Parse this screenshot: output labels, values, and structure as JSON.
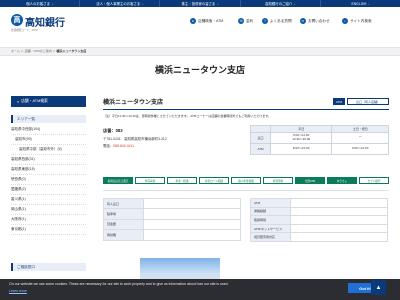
{
  "topnav": [
    {
      "label": "個人のお客さま"
    },
    {
      "label": "法人・個人事業主のお客さま"
    },
    {
      "label": "株主・投資家の皆さま"
    },
    {
      "label": "高知銀行のご紹介"
    },
    {
      "label": "ENGLISH"
    }
  ],
  "header": {
    "logo_mark": "高",
    "logo_text": "高知銀行",
    "bank_code": "金融機関コード：0578",
    "links": {
      "branch_search": "店舗検索・ATM",
      "rates": "金利",
      "faq": "よくある質問",
      "inquiry": "お問い合わせ",
      "sitemap": "サイト内検索"
    }
  },
  "breadcrumb": {
    "home": "ホーム",
    "sep": " ＞ ",
    "mid": "店舗・ATMのご案内",
    "current": "横浜ニュータウン支店"
  },
  "page_title": "横浜ニュータウン支店",
  "sidebar": {
    "head": "店舗・ATM検索",
    "area_label": "エリア一覧",
    "items": [
      {
        "label": "高知県中西部(104)",
        "level": 0
      },
      {
        "label": "高知市(99)",
        "level": 1
      },
      {
        "label": "高知県中部（高知市外）(5)",
        "level": 2
      },
      {
        "label": "高知県西部(31)",
        "level": 0
      },
      {
        "label": "高知県東部(18)",
        "level": 0
      },
      {
        "label": "徳島県(0)",
        "level": 0
      },
      {
        "label": "愛媛県(2)",
        "level": 0
      },
      {
        "label": "香川県(1)",
        "level": 0
      },
      {
        "label": "岡山県(1)",
        "level": 0
      },
      {
        "label": "大阪府(1)",
        "level": 0
      },
      {
        "label": "東京都(1)",
        "level": 0
      }
    ],
    "guide_label": "ご相談窓口"
  },
  "main": {
    "title": "横浜ニュータウン支店",
    "tag_dark": "ATM",
    "tag_outline": "窓口（有人店舗）",
    "notice": "（注）平日11:30～12:30は、昼時間休業とさせていただきます。 ATMコーナーは店舗の営業時間外でもご利用いただけます。",
    "store_no": "店番：083",
    "address": "〒781-0241　高知県高知市横浜新町3-312",
    "tel_label": "電話：",
    "tel": "088-842-4411"
  },
  "hours": {
    "headers": [
      "",
      "平日",
      "土日・祝日"
    ],
    "rows": [
      {
        "label": "窓口",
        "weekday": "9:00～11:30\n12:30～15:00",
        "weekend": "ー"
      },
      {
        "label": "ATM",
        "weekday": "8:00～21:00",
        "weekend": "9:00～21:00"
      }
    ]
  },
  "services": [
    {
      "label": "投資信託窓口販売",
      "on": true
    },
    {
      "label": "外貨両替",
      "on": false
    },
    {
      "label": "年金・相談",
      "on": false
    },
    {
      "label": "住宅ローン相談",
      "on": false
    },
    {
      "label": "個人年金保険",
      "on": false
    },
    {
      "label": "外貨預金",
      "on": false
    },
    {
      "label": "全国ATM",
      "on": true
    },
    {
      "label": "ゆうちょ",
      "on": true
    },
    {
      "label": "セブン銀行",
      "on": false
    }
  ],
  "facilities_left": [
    {
      "label": "有人窓口"
    },
    {
      "label": "駐車場"
    },
    {
      "label": "貸金庫"
    },
    {
      "label": "両替機"
    }
  ],
  "facilities_right": [
    {
      "label": "ATM"
    },
    {
      "label": "通帳繰越"
    },
    {
      "label": "取扱時間"
    },
    {
      "label": "ATM/ネットサービス"
    },
    {
      "label": "視覚障害者対応"
    }
  ],
  "cookie": {
    "text": "On our website we use some cookies. These are necessary for our site to work properly and to give us information about how our site is used.",
    "link": "Learn more",
    "button": "Got it!"
  },
  "colors": {
    "navy": "#0a3a7a",
    "accent_green": "#0a7b5b",
    "tel_red": "#d23b2e"
  }
}
